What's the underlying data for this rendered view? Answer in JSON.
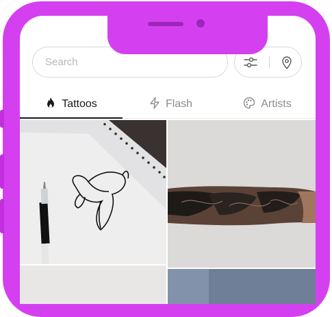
{
  "search": {
    "placeholder": "Search"
  },
  "icons": {
    "filter": "sliders-icon",
    "location": "map-pin-icon"
  },
  "tabs": [
    {
      "label": "Tattoos",
      "icon": "flame-icon",
      "active": true
    },
    {
      "label": "Flash",
      "icon": "lightning-icon",
      "active": false
    },
    {
      "label": "Artists",
      "icon": "palette-icon",
      "active": false
    }
  ],
  "colors": {
    "frame": "#d440f0",
    "active_text": "#1a1a1a",
    "inactive_text": "#8c8c8c"
  }
}
